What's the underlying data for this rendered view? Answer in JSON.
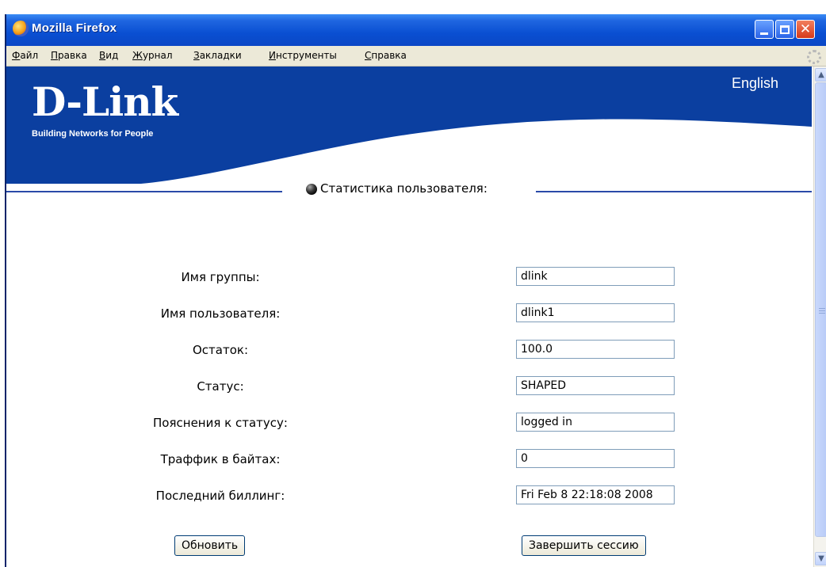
{
  "window": {
    "title": "Mozilla Firefox"
  },
  "menu": {
    "items": [
      {
        "acc": "Ф",
        "rest": "айл"
      },
      {
        "acc": "П",
        "rest": "равка"
      },
      {
        "acc": "В",
        "rest": "ид"
      },
      {
        "acc": "Ж",
        "rest": "урнал"
      },
      {
        "acc": "З",
        "rest": "акладки"
      },
      {
        "acc": "И",
        "rest": "нструменты"
      },
      {
        "acc": "С",
        "rest": "правка"
      }
    ]
  },
  "page": {
    "logo": "D-Link",
    "tagline": "Building Networks for People",
    "language_link": "English",
    "section_title": "Статистика пользователя:",
    "fields": [
      {
        "label": "Имя группы:",
        "value": "dlink"
      },
      {
        "label": "Имя пользователя:",
        "value": "dlink1"
      },
      {
        "label": "Остаток:",
        "value": "100.0"
      },
      {
        "label": "Статус:",
        "value": "SHAPED"
      },
      {
        "label": "Пояснения к статусу:",
        "value": "logged in"
      },
      {
        "label": "Траффик в байтах:",
        "value": "0"
      },
      {
        "label": "Последний биллинг:",
        "value": "Fri Feb  8 22:18:08 2008"
      }
    ],
    "refresh_button": "Обновить",
    "logout_button": "Завершить сессию"
  },
  "colors": {
    "brand_blue": "#0b3fa0",
    "titlebar_blue": "#0a4fd2",
    "menu_bg": "#ece9d8"
  }
}
